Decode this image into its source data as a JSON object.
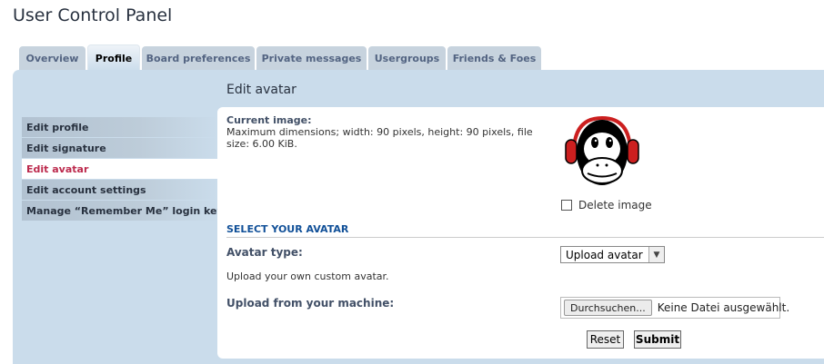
{
  "page": {
    "title": "User Control Panel"
  },
  "tabs": [
    {
      "label": "Overview",
      "active": false
    },
    {
      "label": "Profile",
      "active": true
    },
    {
      "label": "Board preferences",
      "active": false
    },
    {
      "label": "Private messages",
      "active": false
    },
    {
      "label": "Usergroups",
      "active": false
    },
    {
      "label": "Friends & Foes",
      "active": false
    }
  ],
  "sidebar": {
    "items": [
      {
        "label": "Edit profile",
        "active": false
      },
      {
        "label": "Edit signature",
        "active": false
      },
      {
        "label": "Edit avatar",
        "active": true
      },
      {
        "label": "Edit account settings",
        "active": false
      },
      {
        "label": "Manage “Remember Me” login keys",
        "active": false
      }
    ]
  },
  "main": {
    "heading": "Edit avatar",
    "current_image": {
      "label": "Current image:",
      "description": "Maximum dimensions; width: 90 pixels, height: 90 pixels, file size: 6.00 KiB.",
      "image_icon": "monkey-with-headphones-avatar"
    },
    "delete_image": {
      "label": "Delete image",
      "checked": false
    },
    "section_title": "SELECT YOUR AVATAR",
    "avatar_type": {
      "label": "Avatar type:",
      "selected": "Upload avatar",
      "help": "Upload your own custom avatar."
    },
    "upload": {
      "label": "Upload from your machine:",
      "browse_label": "Durchsuchen...",
      "file_status": "Keine Datei ausgewählt."
    },
    "buttons": {
      "reset": "Reset",
      "submit": "Submit"
    }
  },
  "colors": {
    "panel_bg": "#cadceb",
    "tab_bg": "#c7d3de",
    "tab_text": "#536482",
    "active_menu_text": "#bc2a4d",
    "section_text": "#115098",
    "avatar_red": "#cc1f1f"
  }
}
